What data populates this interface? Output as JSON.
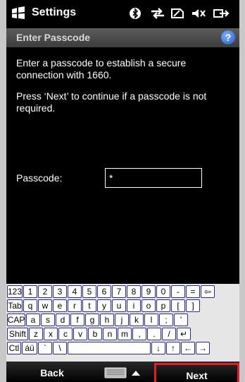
{
  "title_bar": {
    "title": "Settings"
  },
  "subheader": {
    "title": "Enter Passcode",
    "help": "?"
  },
  "body": {
    "instruction": "Enter a passcode to establish a secure connection with 1660.",
    "hint": "Press ‘Next’ to continue if a passcode is not required."
  },
  "passcode": {
    "label": "Passcode:",
    "value": "*"
  },
  "keyboard": {
    "rows": [
      [
        "123",
        "1",
        "2",
        "3",
        "4",
        "5",
        "6",
        "7",
        "8",
        "9",
        "0",
        "-",
        "=",
        "⇦"
      ],
      [
        "Tab",
        "q",
        "w",
        "e",
        "r",
        "t",
        "y",
        "u",
        "i",
        "o",
        "p",
        "[",
        "]"
      ],
      [
        "CAP",
        "a",
        "s",
        "d",
        "f",
        "g",
        "h",
        "j",
        "k",
        "l",
        ";",
        "'"
      ],
      [
        "Shift",
        "z",
        "x",
        "c",
        "v",
        "b",
        "n",
        "m",
        ",",
        ".",
        "/",
        "↵"
      ],
      [
        "Ctl",
        "áü",
        "`",
        "\\",
        " ",
        "↓",
        "↑",
        "←",
        "→"
      ]
    ]
  },
  "bottom_bar": {
    "back": "Back",
    "next": "Next"
  }
}
